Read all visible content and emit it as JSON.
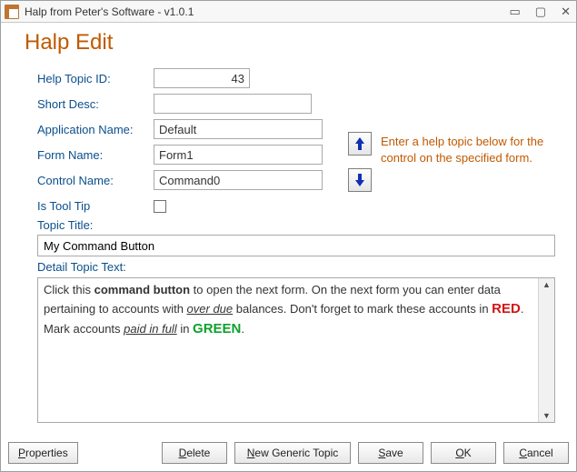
{
  "window": {
    "title": "Halp from Peter's Software - v1.0.1"
  },
  "page": {
    "title": "Halp Edit"
  },
  "labels": {
    "help_topic_id": "Help Topic ID:",
    "short_desc": "Short Desc:",
    "app_name": "Application Name:",
    "form_name": "Form Name:",
    "control_name": "Control Name:",
    "is_tooltip": "Is Tool Tip",
    "topic_title": "Topic Title:",
    "detail_topic_text": "Detail Topic Text:"
  },
  "fields": {
    "help_topic_id": "43",
    "short_desc": "",
    "app_name": "Default",
    "form_name": "Form1",
    "control_name": "Command0",
    "topic_title": "My Command Button"
  },
  "hint": "Enter a help topic below for the control on the specified form.",
  "detail": {
    "t1": "Click this ",
    "bold1": "command button",
    "t2": " to open the next form. On the next form you can enter data pertaining to accounts with ",
    "ul1": "over due",
    "t3": " balances. Don't forget to mark these accounts in ",
    "red": "RED",
    "t4": ". Mark accounts ",
    "ul2": "paid in full",
    "t5": " in ",
    "green": "GREEN",
    "t6": "."
  },
  "buttons": {
    "properties": {
      "ak": "P",
      "rest": "roperties"
    },
    "delete": {
      "ak": "D",
      "rest": "elete"
    },
    "new_generic": {
      "ak": "N",
      "rest": "ew Generic Topic"
    },
    "save": {
      "ak": "S",
      "rest": "ave"
    },
    "ok": {
      "ak": "O",
      "rest": "K"
    },
    "cancel": {
      "ak": "C",
      "rest": "ancel"
    }
  }
}
